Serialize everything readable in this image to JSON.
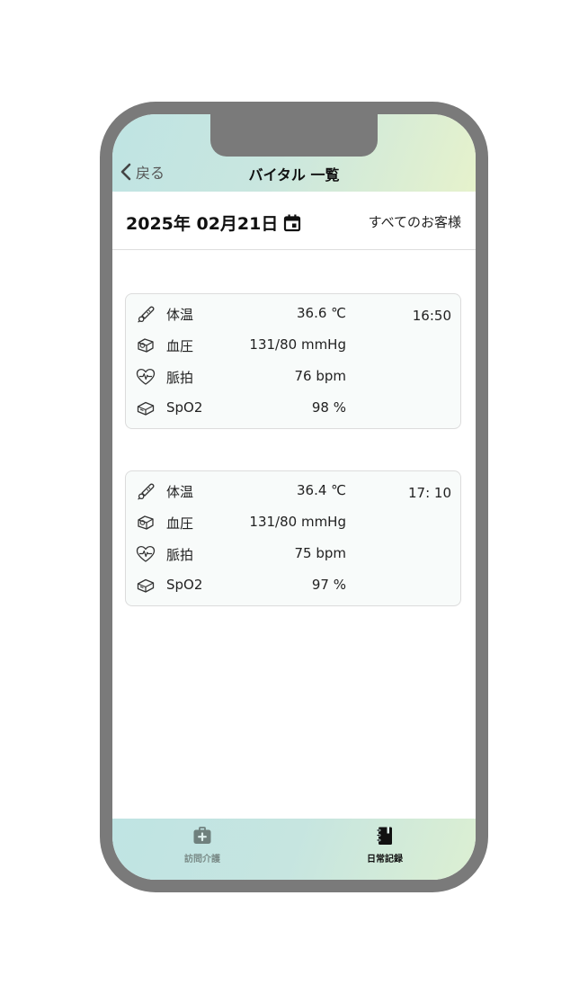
{
  "header": {
    "back_label": "戻る",
    "title": "バイタル 一覧"
  },
  "date_bar": {
    "date": "2025年 02月21日",
    "filter": "すべてのお客様"
  },
  "records": [
    {
      "time": "16:50",
      "vitals": [
        {
          "icon": "thermometer-icon",
          "label": "体温",
          "value": "36.6 ℃"
        },
        {
          "icon": "blood-pressure-cuff-icon",
          "label": "血圧",
          "value": "131/80 mmHg"
        },
        {
          "icon": "heart-pulse-icon",
          "label": "脈拍",
          "value": "76 bpm"
        },
        {
          "icon": "pulse-oximeter-icon",
          "label": "SpO2",
          "value": "98 %"
        }
      ]
    },
    {
      "time": "17: 10",
      "vitals": [
        {
          "icon": "thermometer-icon",
          "label": "体温",
          "value": "36.4 ℃"
        },
        {
          "icon": "blood-pressure-cuff-icon",
          "label": "血圧",
          "value": "131/80 mmHg"
        },
        {
          "icon": "heart-pulse-icon",
          "label": "脈拍",
          "value": "75 bpm"
        },
        {
          "icon": "pulse-oximeter-icon",
          "label": "SpO2",
          "value": "97 %"
        }
      ]
    }
  ],
  "tabbar": {
    "tabs": [
      {
        "label": "訪問介護",
        "icon": "medical-bag-icon",
        "active": false
      },
      {
        "label": "日常記録",
        "icon": "notebook-icon",
        "active": true
      }
    ]
  },
  "colors": {
    "frame": "#7a7a7a",
    "header_gradient_start": "#bfe4e3",
    "header_gradient_end": "#e6f2cc",
    "card_background": "#f8fbfa"
  }
}
